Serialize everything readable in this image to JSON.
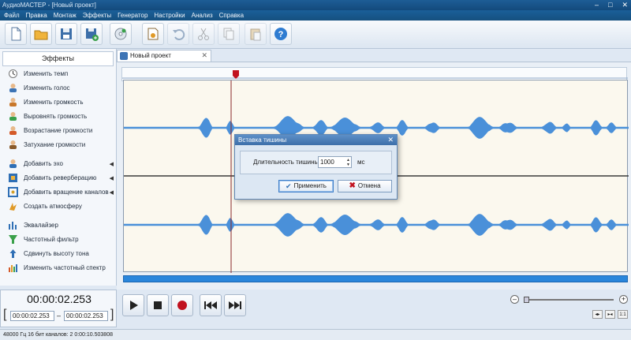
{
  "window": {
    "title": "АудиоМАСТЕР - [Новый проект]"
  },
  "menu": [
    "Файл",
    "Правка",
    "Монтаж",
    "Эффекты",
    "Генератор",
    "Настройки",
    "Анализ",
    "Справка"
  ],
  "toolbar": {
    "buttons": [
      "new-file",
      "open-folder",
      "save",
      "save-as",
      "cd",
      "audio",
      "undo",
      "cut",
      "copy",
      "paste",
      "help"
    ]
  },
  "sidebar": {
    "title": "Эффекты",
    "items": [
      {
        "label": "Изменить темп",
        "icon": "tempo-icon"
      },
      {
        "label": "Изменить голос",
        "icon": "voice-icon"
      },
      {
        "label": "Изменить громкость",
        "icon": "volume-icon"
      },
      {
        "label": "Выровнять громкость",
        "icon": "normalize-icon"
      },
      {
        "label": "Возрастание громкости",
        "icon": "fade-in-icon"
      },
      {
        "label": "Затухание громкости",
        "icon": "fade-out-icon"
      },
      {
        "label": "Добавить эхо",
        "icon": "echo-icon"
      },
      {
        "label": "Добавить реверберацию",
        "icon": "reverb-icon"
      },
      {
        "label": "Добавить вращение каналов",
        "icon": "rotate-icon"
      },
      {
        "label": "Создать атмосферу",
        "icon": "atmosphere-icon"
      },
      {
        "label": "Эквалайзер",
        "icon": "equalizer-icon"
      },
      {
        "label": "Частотный фильтр",
        "icon": "filter-icon"
      },
      {
        "label": "Сдвинуть высоту тона",
        "icon": "pitch-icon"
      },
      {
        "label": "Изменить частотный спектр",
        "icon": "spectrum-icon"
      }
    ]
  },
  "tab": {
    "label": "Новый проект"
  },
  "dialog": {
    "title": "Вставка тишины",
    "field_label": "Длительность тишины:",
    "value": "1000",
    "unit": "мс",
    "ok": "Применить",
    "cancel": "Отмена"
  },
  "time": {
    "current": "00:00:02.253",
    "start": "00:00:02.253",
    "separator": "–",
    "end": "00:00:02.253"
  },
  "zoom": {
    "fit_label": "1:1"
  },
  "status": "48000 Гц  16 бит  каналов: 2  0:00:10.503808",
  "colors": {
    "waveform": "#4a90d9",
    "accent": "#2a86db",
    "playhead": "#c1121f"
  }
}
